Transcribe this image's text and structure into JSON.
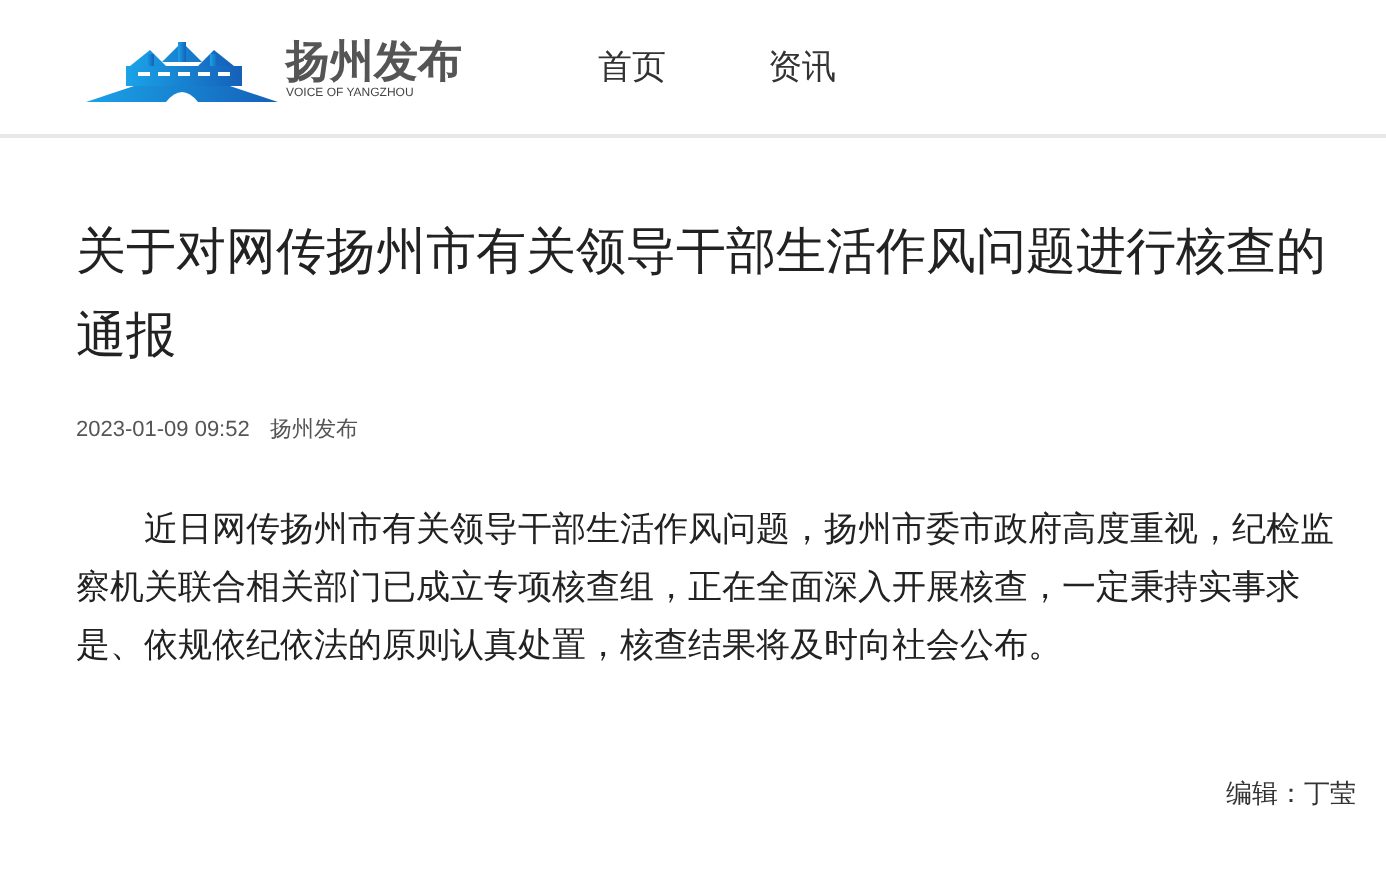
{
  "header": {
    "logo": {
      "name": "扬州发布",
      "tagline": "VOICE OF YANGZHOU"
    },
    "nav": [
      {
        "label": "首页"
      },
      {
        "label": "资讯"
      }
    ]
  },
  "article": {
    "title": "关于对网传扬州市有关领导干部生活作风问题进行核查的通报",
    "date": "2023-01-09 09:52",
    "source": "扬州发布",
    "body": "近日网传扬州市有关领导干部生活作风问题，扬州市委市政府高度重视，纪检监察机关联合相关部门已成立专项核查组，正在全面深入开展核查，一定秉持实事求是、依规依纪依法的原则认真处置，核查结果将及时向社会公布。",
    "editor": "编辑：丁莹"
  }
}
